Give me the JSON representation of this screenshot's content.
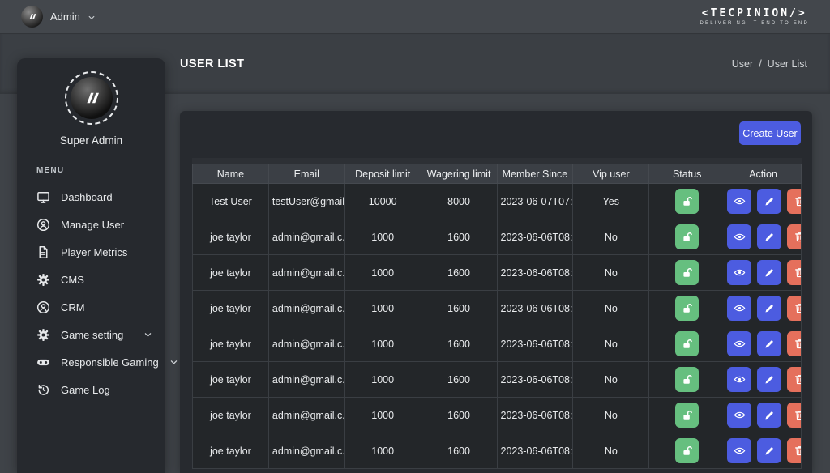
{
  "navbar": {
    "user_label": "Admin",
    "brand_text": "<TECPINION/>",
    "brand_tagline": "DELIVERING IT END TO END"
  },
  "sidebar": {
    "profile_name": "Super Admin",
    "section_label": "MENU",
    "items": [
      {
        "label": "Dashboard",
        "icon": "dashboard",
        "expandable": false
      },
      {
        "label": "Manage User",
        "icon": "user-circle",
        "expandable": false
      },
      {
        "label": "Player Metrics",
        "icon": "file",
        "expandable": false
      },
      {
        "label": "CMS",
        "icon": "gear",
        "expandable": false
      },
      {
        "label": "CRM",
        "icon": "user-circle",
        "expandable": false
      },
      {
        "label": "Game setting",
        "icon": "gear",
        "expandable": true
      },
      {
        "label": "Responsible Gaming",
        "icon": "gamepad",
        "expandable": true
      },
      {
        "label": "Game Log",
        "icon": "history",
        "expandable": false
      }
    ]
  },
  "page": {
    "title": "USER LIST",
    "breadcrumb": {
      "parent": "User",
      "separator": "/",
      "current": "User List"
    },
    "create_button_label": "Create User"
  },
  "table": {
    "columns": [
      "Name",
      "Email",
      "Deposit limit",
      "Wagering limit",
      "Member Since",
      "Vip user",
      "Status",
      "Action"
    ],
    "rows": [
      {
        "name": "Test User",
        "email": "testUser@gmail...",
        "deposit_limit": "10000",
        "wagering_limit": "8000",
        "member_since": "2023-06-07T07:...",
        "vip_user": "Yes"
      },
      {
        "name": "joe taylor",
        "email": "admin@gmail.c...",
        "deposit_limit": "1000",
        "wagering_limit": "1600",
        "member_since": "2023-06-06T08:...",
        "vip_user": "No"
      },
      {
        "name": "joe taylor",
        "email": "admin@gmail.c...",
        "deposit_limit": "1000",
        "wagering_limit": "1600",
        "member_since": "2023-06-06T08:...",
        "vip_user": "No"
      },
      {
        "name": "joe taylor",
        "email": "admin@gmail.c...",
        "deposit_limit": "1000",
        "wagering_limit": "1600",
        "member_since": "2023-06-06T08:...",
        "vip_user": "No"
      },
      {
        "name": "joe taylor",
        "email": "admin@gmail.c...",
        "deposit_limit": "1000",
        "wagering_limit": "1600",
        "member_since": "2023-06-06T08:...",
        "vip_user": "No"
      },
      {
        "name": "joe taylor",
        "email": "admin@gmail.c...",
        "deposit_limit": "1000",
        "wagering_limit": "1600",
        "member_since": "2023-06-06T08:...",
        "vip_user": "No"
      },
      {
        "name": "joe taylor",
        "email": "admin@gmail.c...",
        "deposit_limit": "1000",
        "wagering_limit": "1600",
        "member_since": "2023-06-06T08:...",
        "vip_user": "No"
      },
      {
        "name": "joe taylor",
        "email": "admin@gmail.c...",
        "deposit_limit": "1000",
        "wagering_limit": "1600",
        "member_since": "2023-06-06T08:...",
        "vip_user": "No"
      }
    ]
  },
  "colors": {
    "accent_blue": "#4c5ce0",
    "success_green": "#66bf7f",
    "danger_red": "#e5705c"
  }
}
